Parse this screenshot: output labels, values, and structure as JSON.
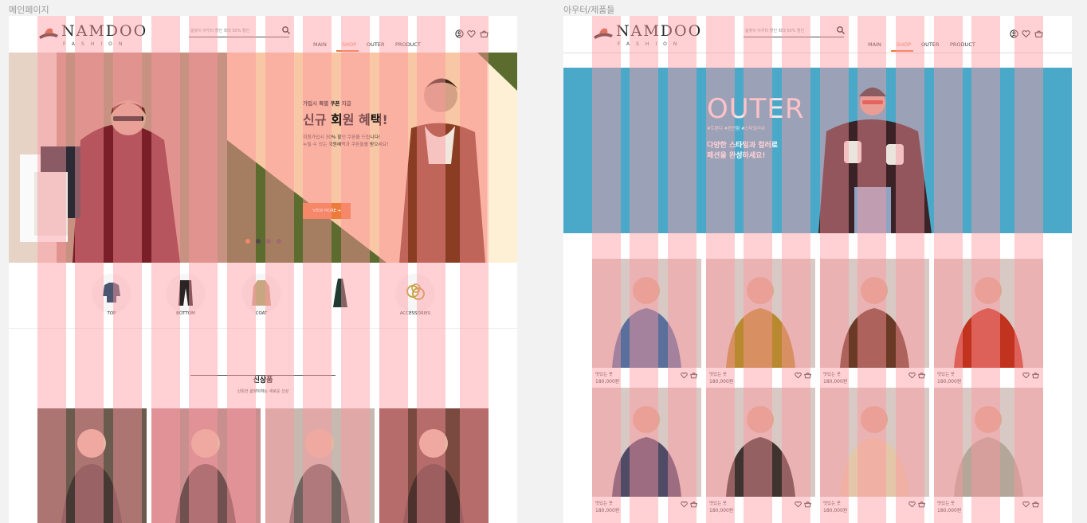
{
  "frames": {
    "main_label": "메인페이지",
    "outer_label": "아우터/제품들"
  },
  "brand": {
    "name": "NAMDOO",
    "sub": "FASHION"
  },
  "search": {
    "placeholder": "봄맞이 아우터 할인 최대 50% 할인"
  },
  "nav": {
    "items": [
      "MAIN",
      "SHOP",
      "OUTER",
      "PRODUCT"
    ],
    "active": "SHOP"
  },
  "header_icons": [
    "user-icon",
    "heart-icon",
    "basket-icon"
  ],
  "hero": {
    "kicker": "가입시 특별 쿠폰 지급",
    "title": "신규 회원 혜택!",
    "desc_line1": "회원가입시 30% 할인 쿠폰을 드립니다!",
    "desc_line2": "누릴 수 있는 회원혜택과 쿠폰들을 받으세요!",
    "button": "VIEW MORE",
    "dots": 4,
    "active_dot": 0,
    "colors": {
      "peach": "#f8c7a5",
      "cream": "#fdf0d5",
      "olive": "#5c6b2e",
      "orange": "#ee7a3b"
    }
  },
  "categories": [
    {
      "label": "TOP",
      "icon": "shirt-icon"
    },
    {
      "label": "BOTTOM",
      "icon": "pants-icon"
    },
    {
      "label": "COAT",
      "icon": "coat-icon"
    },
    {
      "label": "",
      "icon": "dress-icon"
    },
    {
      "label": "ACCESSORIES",
      "icon": "accessories-icon"
    }
  ],
  "new_section": {
    "title": "신상품",
    "subtitle": "산뜻한 봄맞이하는 새로운 신상"
  },
  "outer_banner": {
    "title": "OUTER",
    "tags": "#트렌디 #편안함 #스타일리쉬",
    "desc_line1": "다양한 스타일과 컬러로",
    "desc_line2": "패션을 완성하세요!",
    "color": "#4aa9c9"
  },
  "outer_products": [
    {
      "name": "멋있는 옷",
      "price": "180,000원",
      "tone": "#5a6f9c"
    },
    {
      "name": "멋있는 옷",
      "price": "180,000원",
      "tone": "#b8892f"
    },
    {
      "name": "멋있는 옷",
      "price": "180,000원",
      "tone": "#6a3a26"
    },
    {
      "name": "멋있는 옷",
      "price": "180,000원",
      "tone": "#c2331f"
    },
    {
      "name": "멋있는 옷",
      "price": "180,000원",
      "tone": "#4f4a66"
    },
    {
      "name": "멋있는 옷",
      "price": "180,000원",
      "tone": "#3e332e"
    },
    {
      "name": "멋있는 옷",
      "price": "180,000원",
      "tone": "#e4c7a8"
    },
    {
      "name": "멋있는 옷",
      "price": "180,000원",
      "tone": "#b4a79a"
    }
  ],
  "new_products": [
    {
      "tone": "#6b5a4e"
    },
    {
      "tone": "#c98f8f"
    },
    {
      "tone": "#c7b8b0"
    },
    {
      "tone": "#7a4a40"
    }
  ],
  "grid_overlay_color": "#ff96a0"
}
